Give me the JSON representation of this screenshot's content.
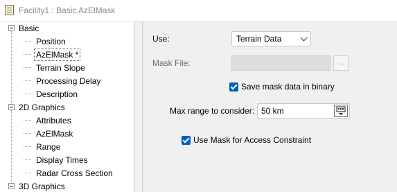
{
  "window": {
    "title": "Facility1 : Basic AzElMask"
  },
  "tree": {
    "categories": [
      {
        "label": "Basic",
        "items": [
          "Position",
          "AzElMask *",
          "Terrain Slope",
          "Processing Delay",
          "Description"
        ]
      },
      {
        "label": "2D Graphics",
        "items": [
          "Attributes",
          "AzElMask",
          "Range",
          "Display Times",
          "Radar Cross Section"
        ]
      },
      {
        "label": "3D Graphics",
        "items": []
      }
    ],
    "selected_item": "AzElMask *"
  },
  "form": {
    "use_label": "Use:",
    "use_value": "Terrain Data",
    "mask_file_label": "Mask File:",
    "mask_file_value": "",
    "browse_label": "...",
    "save_binary_label": "Save mask data in binary",
    "save_binary_checked": true,
    "max_range_label": "Max range to consider:",
    "max_range_value": "50 km",
    "use_mask_label": "Use Mask for Access Constraint",
    "use_mask_checked": true
  },
  "colors": {
    "accent": "#005fb8",
    "disabled_text": "#6d6d6d",
    "title_text": "#8a8a8a"
  }
}
